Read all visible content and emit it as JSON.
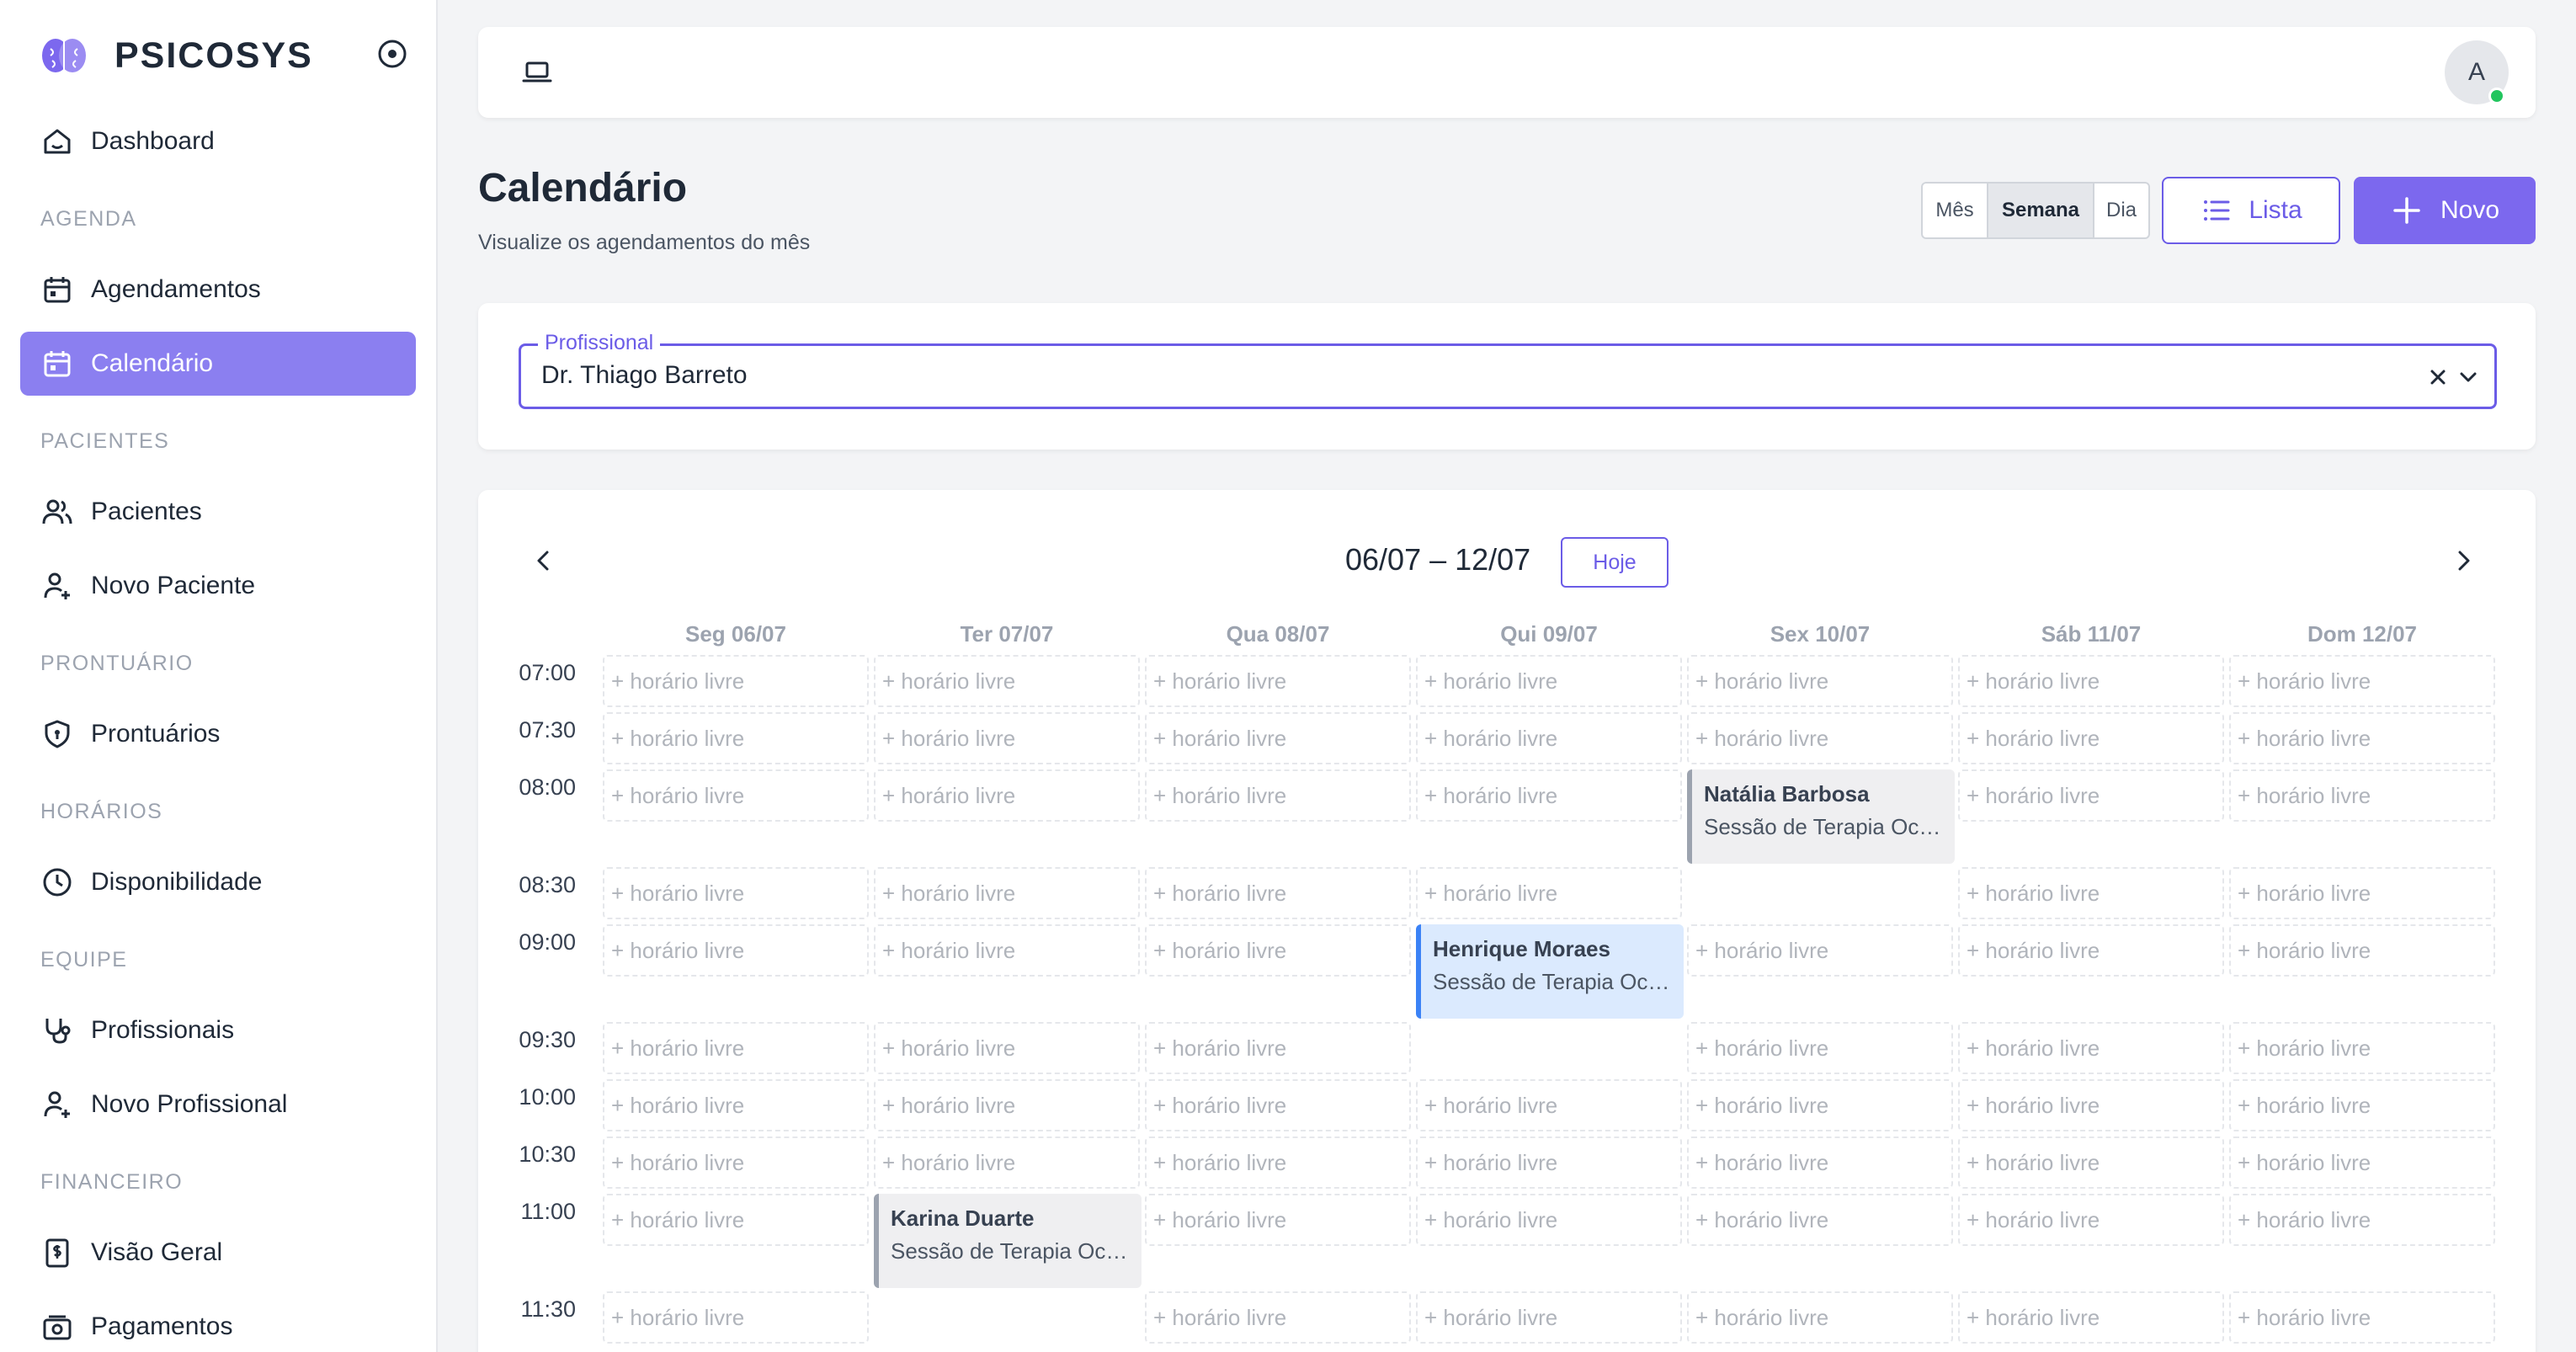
{
  "brand": {
    "name": "PSICOSYS"
  },
  "sidebar": {
    "dashboard": "Dashboard",
    "sections": {
      "agenda": "AGENDA",
      "pacientes": "PACIENTES",
      "prontuario": "PRONTUÁRIO",
      "horarios": "HORÁRIOS",
      "equipe": "EQUIPE",
      "financeiro": "FINANCEIRO"
    },
    "items": {
      "agendamentos": "Agendamentos",
      "calendario": "Calendário",
      "pacientes": "Pacientes",
      "novo_paciente": "Novo Paciente",
      "prontuarios": "Prontuários",
      "disponibilidade": "Disponibilidade",
      "profissionais": "Profissionais",
      "novo_profissional": "Novo Profissional",
      "visao_geral": "Visão Geral",
      "pagamentos": "Pagamentos"
    }
  },
  "topbar": {
    "avatar_initial": "A"
  },
  "header": {
    "title": "Calendário",
    "subtitle": "Visualize os agendamentos do mês",
    "view_month": "Mês",
    "view_week": "Semana",
    "view_day": "Dia",
    "list_label": "Lista",
    "new_label": "Novo"
  },
  "filter": {
    "legend": "Profissional",
    "value": "Dr. Thiago Barreto"
  },
  "calendar": {
    "range": "06/07 – 12/07",
    "today_label": "Hoje",
    "free_slot_label": "+ horário livre",
    "days": [
      "Seg 06/07",
      "Ter 07/07",
      "Qua 08/07",
      "Qui 09/07",
      "Sex 10/07",
      "Sáb 11/07",
      "Dom 12/07"
    ],
    "times": [
      "07:00",
      "07:30",
      "08:00",
      "08:30",
      "09:00",
      "09:30",
      "10:00",
      "10:30",
      "11:00",
      "11:30"
    ],
    "events": [
      {
        "day": 4,
        "time": "08:00",
        "name": "Natália Barbosa",
        "desc": "Sessão de Terapia Ocupacional",
        "color": "gray"
      },
      {
        "day": 3,
        "time": "09:00",
        "name": "Henrique Moraes",
        "desc": "Sessão de Terapia Ocupacional",
        "color": "blue"
      },
      {
        "day": 1,
        "time": "11:00",
        "name": "Karina Duarte",
        "desc": "Sessão de Terapia Ocupacional",
        "color": "gray"
      }
    ]
  },
  "colors": {
    "accent": "#6b5ce7",
    "active_nav": "#8b7ff0",
    "event_blue": "#dbeafe",
    "event_gray": "#efeff1",
    "online": "#22c55e"
  }
}
